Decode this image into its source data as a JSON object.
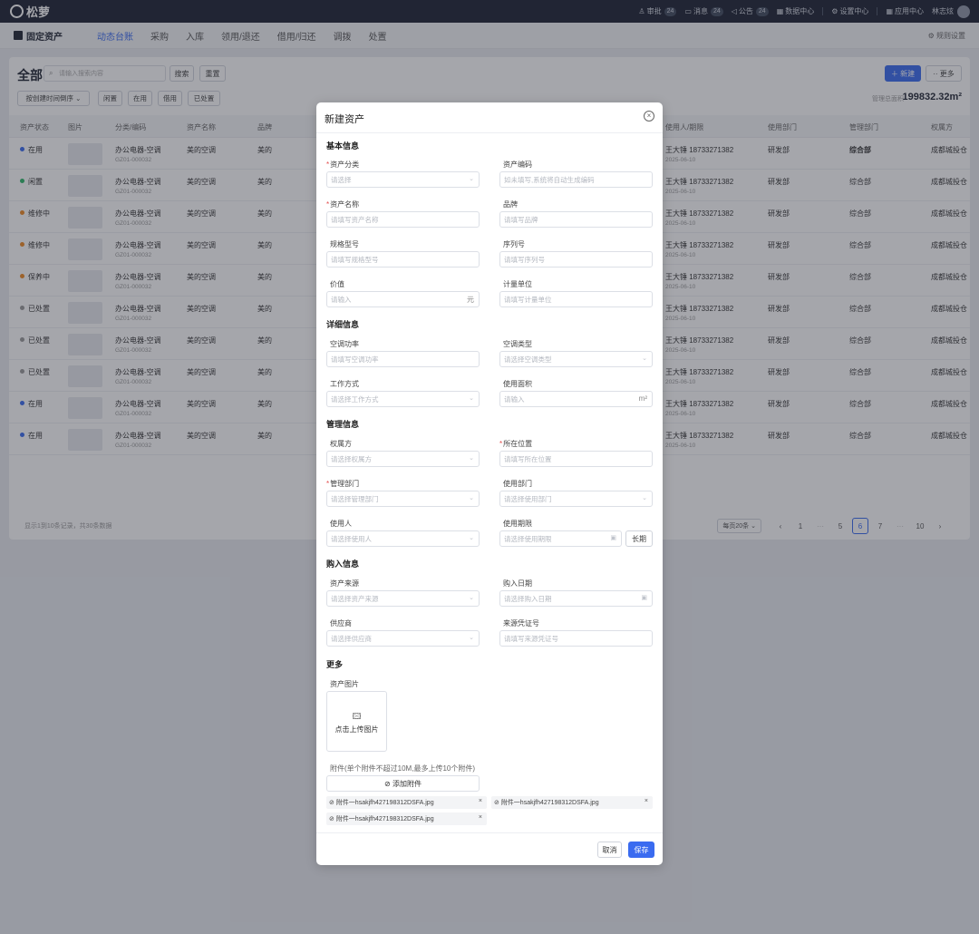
{
  "topbar": {
    "logo": "松萝",
    "approval": {
      "label": "审批",
      "count": "24"
    },
    "message": {
      "label": "消息",
      "count": "24"
    },
    "notice": {
      "label": "公告",
      "count": "24"
    },
    "data_center": "数据中心",
    "settings_center": "设置中心",
    "app_center": "应用中心",
    "user": "林志炫"
  },
  "subnav": {
    "brand": "固定资产",
    "tabs": [
      "动态台账",
      "采购",
      "入库",
      "领用/退还",
      "借用/归还",
      "调拨",
      "处置"
    ],
    "rules": "规则设置"
  },
  "list": {
    "title": "全部",
    "search_placeholder": "请输入搜索内容",
    "search_btn": "搜索",
    "reset_btn": "重置",
    "new_btn": "新建",
    "more_btn": "更多",
    "sort": "按创建时间倒序",
    "filters": [
      "闲置",
      "在用",
      "借用",
      "已处置"
    ],
    "area_label": "管理总面积",
    "area_value": "199832.32m²",
    "columns": [
      "资产状态",
      "图片",
      "分类/编码",
      "资产名称",
      "品牌",
      "使用人/期限",
      "使用部门",
      "管理部门",
      "权属方"
    ],
    "status_colors": {
      "在用": "#3a6bf0",
      "闲置": "#2fb86a",
      "维修中": "#f08a24",
      "保养中": "#f08a24",
      "已处置": "#999999"
    },
    "rows": [
      {
        "status": "在用",
        "category": "办公电器-空调",
        "code": "GZ01-000032",
        "name": "美的空调",
        "brand": "美的",
        "user": "王大锤 18733271382",
        "term": "2025-06-10",
        "dept": "研发部",
        "mgmt": "综合部",
        "owner": "成都城投仓"
      },
      {
        "status": "闲置",
        "category": "办公电器-空调",
        "code": "GZ01-000032",
        "name": "美的空调",
        "brand": "美的",
        "user": "王大锤 18733271382",
        "term": "2025-06-10",
        "dept": "研发部",
        "mgmt": "综合部",
        "owner": "成都城投仓"
      },
      {
        "status": "维修中",
        "category": "办公电器-空调",
        "code": "GZ01-000032",
        "name": "美的空调",
        "brand": "美的",
        "user": "王大锤 18733271382",
        "term": "2025-06-10",
        "dept": "研发部",
        "mgmt": "综合部",
        "owner": "成都城投仓"
      },
      {
        "status": "维修中",
        "category": "办公电器-空调",
        "code": "GZ01-000032",
        "name": "美的空调",
        "brand": "美的",
        "user": "王大锤 18733271382",
        "term": "2025-06-10",
        "dept": "研发部",
        "mgmt": "综合部",
        "owner": "成都城投仓"
      },
      {
        "status": "保养中",
        "category": "办公电器-空调",
        "code": "GZ01-000032",
        "name": "美的空调",
        "brand": "美的",
        "user": "王大锤 18733271382",
        "term": "2025-06-10",
        "dept": "研发部",
        "mgmt": "综合部",
        "owner": "成都城投仓"
      },
      {
        "status": "已处置",
        "category": "办公电器-空调",
        "code": "GZ01-000032",
        "name": "美的空调",
        "brand": "美的",
        "user": "王大锤 18733271382",
        "term": "2025-06-10",
        "dept": "研发部",
        "mgmt": "综合部",
        "owner": "成都城投仓"
      },
      {
        "status": "已处置",
        "category": "办公电器-空调",
        "code": "GZ01-000032",
        "name": "美的空调",
        "brand": "美的",
        "user": "王大锤 18733271382",
        "term": "2025-06-10",
        "dept": "研发部",
        "mgmt": "综合部",
        "owner": "成都城投仓"
      },
      {
        "status": "已处置",
        "category": "办公电器-空调",
        "code": "GZ01-000032",
        "name": "美的空调",
        "brand": "美的",
        "user": "王大锤 18733271382",
        "term": "2025-06-10",
        "dept": "研发部",
        "mgmt": "综合部",
        "owner": "成都城投仓"
      },
      {
        "status": "在用",
        "category": "办公电器-空调",
        "code": "GZ01-000032",
        "name": "美的空调",
        "brand": "美的",
        "user": "王大锤 18733271382",
        "term": "2025-06-10",
        "dept": "研发部",
        "mgmt": "综合部",
        "owner": "成都城投仓"
      },
      {
        "status": "在用",
        "category": "办公电器-空调",
        "code": "GZ01-000032",
        "name": "美的空调",
        "brand": "美的",
        "user": "王大锤 18733271382",
        "term": "2025-06-10",
        "dept": "研发部",
        "mgmt": "综合部",
        "owner": "成都城投仓"
      }
    ],
    "footer_info": "显示1到10条记录，共30条数据",
    "page_size": "每页20条",
    "pages": [
      "1",
      "5",
      "6",
      "7",
      "10"
    ],
    "current_page": "6"
  },
  "modal": {
    "title": "新建资产",
    "sections": {
      "basic": "基本信息",
      "detail": "详细信息",
      "manage": "管理信息",
      "purchase": "购入信息",
      "more": "更多"
    },
    "fields": {
      "category": {
        "label": "资产分类",
        "placeholder": "请选择"
      },
      "code": {
        "label": "资产编码",
        "placeholder": "如未填写,系统将自动生成编码"
      },
      "name": {
        "label": "资产名称",
        "placeholder": "请填写资产名称"
      },
      "brand": {
        "label": "品牌",
        "placeholder": "请填写品牌"
      },
      "model": {
        "label": "规格型号",
        "placeholder": "请填写规格型号"
      },
      "serial": {
        "label": "序列号",
        "placeholder": "请填写序列号"
      },
      "price": {
        "label": "价值",
        "placeholder": "请输入",
        "suffix": "元"
      },
      "unit": {
        "label": "计量单位",
        "placeholder": "请填写计量单位"
      },
      "power": {
        "label": "空调功率",
        "placeholder": "请填写空调功率"
      },
      "ac_type": {
        "label": "空调类型",
        "placeholder": "请选择空调类型"
      },
      "work_mode": {
        "label": "工作方式",
        "placeholder": "请选择工作方式"
      },
      "area": {
        "label": "使用面积",
        "placeholder": "请输入",
        "suffix": "m²"
      },
      "owner": {
        "label": "权属方",
        "placeholder": "请选择权属方"
      },
      "location": {
        "label": "所在位置",
        "placeholder": "请填写所在位置"
      },
      "mgmt_dept": {
        "label": "管理部门",
        "placeholder": "请选择管理部门"
      },
      "use_dept": {
        "label": "使用部门",
        "placeholder": "请选择使用部门"
      },
      "user": {
        "label": "使用人",
        "placeholder": "请选择使用人"
      },
      "use_term": {
        "label": "使用期限",
        "placeholder": "请选择使用期限",
        "long_btn": "长期"
      },
      "source": {
        "label": "资产来源",
        "placeholder": "请选择资产来源"
      },
      "buy_date": {
        "label": "购入日期",
        "placeholder": "请选择购入日期"
      },
      "supplier": {
        "label": "供应商",
        "placeholder": "请选择供应商"
      },
      "voucher": {
        "label": "来源凭证号",
        "placeholder": "请填写来源凭证号"
      }
    },
    "image_label": "资产图片",
    "upload_text": "点击上传图片",
    "attach_hint": "附件(单个附件不超过10M,最多上传10个附件)",
    "add_attach": "添加附件",
    "attachments": [
      "附件一hsakjfh427198312DSFA.jpg",
      "附件一hsakjfh427198312DSFA.jpg",
      "附件一hsakjfh427198312DSFA.jpg"
    ],
    "cancel": "取消",
    "save": "保存"
  }
}
